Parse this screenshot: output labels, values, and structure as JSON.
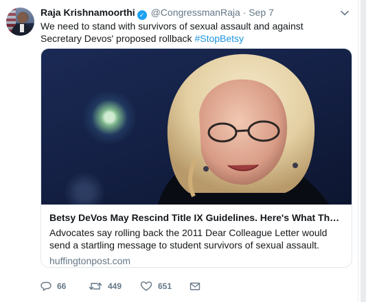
{
  "tweet": {
    "author_name": "Raja Krishnamoorthi",
    "verified_icon": "verified-badge-icon",
    "handle": "@CongressmanRaja",
    "separator": "·",
    "timestamp": "Sep 7",
    "text": "We need to stand with survivors of sexual assault and against Secretary Devos' proposed rollback",
    "hashtag": "#StopBetsy"
  },
  "card": {
    "title": "Betsy DeVos May Rescind Title IX Guidelines. Here's What That Coul...",
    "description": "Advocates say rolling back the 2011 Dear Colleague Letter would send a startling message to student survivors of sexual assault.",
    "domain": "huffingtonpost.com"
  },
  "actions": {
    "reply_count": "66",
    "retweet_count": "449",
    "like_count": "651"
  },
  "colors": {
    "accent": "#1da1f2",
    "link": "#1b95e0",
    "muted": "#657786"
  }
}
